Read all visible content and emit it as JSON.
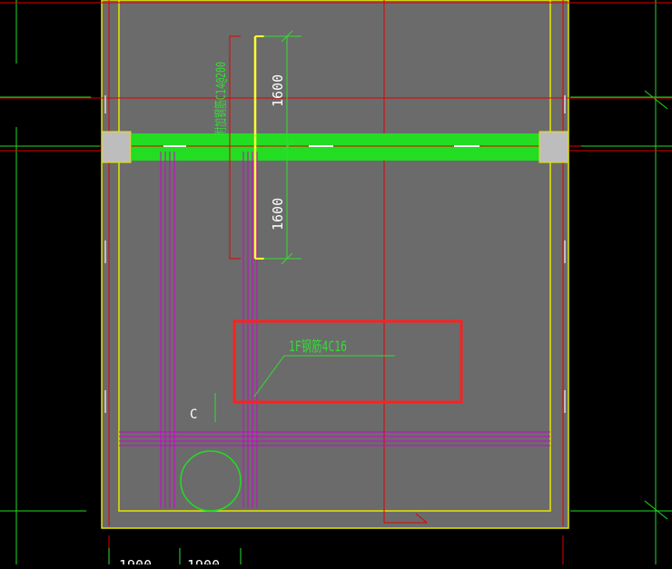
{
  "colors": {
    "background": "#000000",
    "slab": "#6b6b6b",
    "slab_edge": "#e6e600",
    "axis": "#e00000",
    "beam": "#22dd22",
    "dim": "#33dd33",
    "rebar_magenta": "#d000d0",
    "rebar_yellow": "#ffff33",
    "highlight": "#ff2020",
    "column": "#bdbdbd"
  },
  "labels": {
    "dim_top": "1600",
    "dim_bottom": "1600",
    "rebar_vertical": "附加钢筋C14@200",
    "rebar_note": "1F钢筋4C16",
    "grid_c": "C",
    "bottom_dim_left": "1900",
    "bottom_dim_right": "1900"
  },
  "icons": {
    "pile": "circle-icon",
    "column": "square-icon"
  }
}
